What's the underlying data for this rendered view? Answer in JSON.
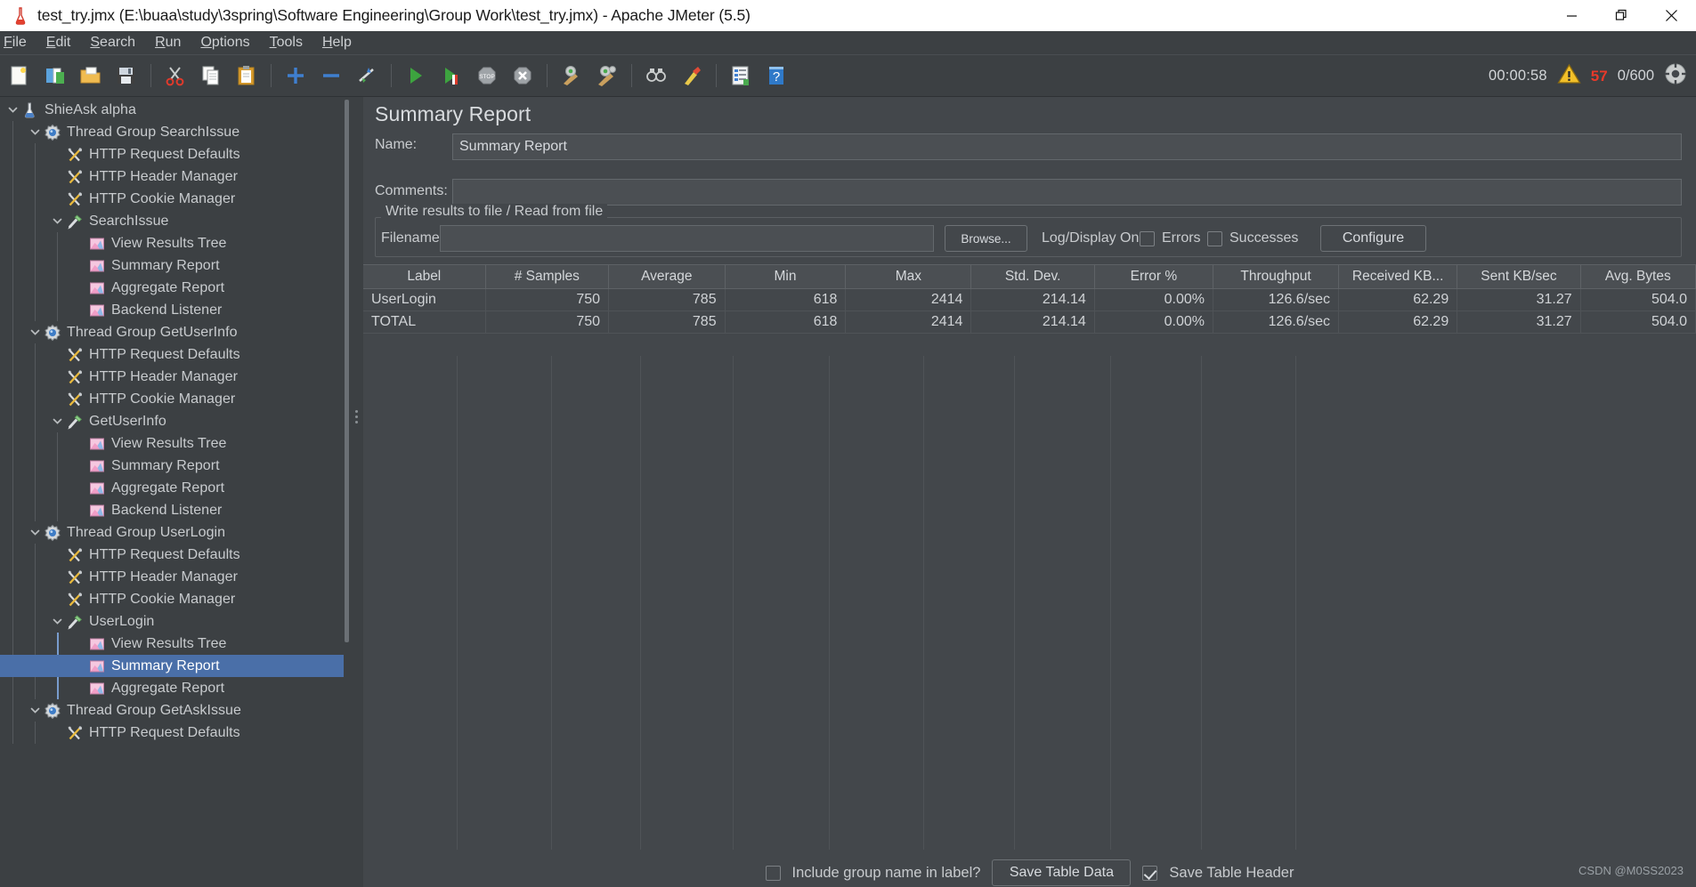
{
  "window": {
    "title": "test_try.jmx (E:\\buaa\\study\\3spring\\Software Engineering\\Group Work\\test_try.jmx) - Apache JMeter (5.5)",
    "app_icon": "jmeter-icon",
    "minimize_label": "Minimize",
    "maximize_label": "Restore",
    "close_label": "Close"
  },
  "menubar": {
    "items": [
      {
        "label": "File",
        "mnemonic": "F"
      },
      {
        "label": "Edit",
        "mnemonic": "E"
      },
      {
        "label": "Search",
        "mnemonic": "S"
      },
      {
        "label": "Run",
        "mnemonic": "R"
      },
      {
        "label": "Options",
        "mnemonic": "O"
      },
      {
        "label": "Tools",
        "mnemonic": "T"
      },
      {
        "label": "Help",
        "mnemonic": "H"
      }
    ]
  },
  "toolbar": {
    "buttons": [
      {
        "name": "new-icon",
        "tooltip": "New"
      },
      {
        "name": "templates-icon",
        "tooltip": "Templates"
      },
      {
        "name": "open-icon",
        "tooltip": "Open"
      },
      {
        "name": "save-icon",
        "tooltip": "Save"
      },
      {
        "name": "cut-icon",
        "tooltip": "Cut"
      },
      {
        "name": "copy-icon",
        "tooltip": "Copy"
      },
      {
        "name": "paste-icon",
        "tooltip": "Paste"
      },
      {
        "name": "expand-all-icon",
        "tooltip": "Expand All"
      },
      {
        "name": "collapse-all-icon",
        "tooltip": "Collapse All"
      },
      {
        "name": "toggle-icon",
        "tooltip": "Toggle"
      },
      {
        "name": "start-icon",
        "tooltip": "Start"
      },
      {
        "name": "start-no-pauses-icon",
        "tooltip": "Start no pauses"
      },
      {
        "name": "stop-icon",
        "tooltip": "Stop"
      },
      {
        "name": "shutdown-icon",
        "tooltip": "Shutdown"
      },
      {
        "name": "clear-icon",
        "tooltip": "Clear"
      },
      {
        "name": "clear-all-icon",
        "tooltip": "Clear All"
      },
      {
        "name": "search-icon",
        "tooltip": "Search"
      },
      {
        "name": "search-reset-icon",
        "tooltip": "Reset Search"
      },
      {
        "name": "function-helper-icon",
        "tooltip": "Function Helper Dialog"
      },
      {
        "name": "help-icon",
        "tooltip": "Help"
      }
    ],
    "status": {
      "elapsed_time": "00:00:58",
      "warning_icon": "warning-triangle-icon",
      "warning_count": "57",
      "active_threads": "0/600",
      "connection_icon": "connection-status-icon"
    }
  },
  "tree": {
    "items": [
      {
        "label": "ShieAsk alpha",
        "indent": 0,
        "icon": "test-plan-icon",
        "twisty": "down",
        "selected": false
      },
      {
        "label": "Thread Group SearchIssue",
        "indent": 1,
        "icon": "thread-group-icon",
        "twisty": "down",
        "selected": false
      },
      {
        "label": "HTTP Request Defaults",
        "indent": 2,
        "icon": "config-element-icon",
        "twisty": "none",
        "selected": false
      },
      {
        "label": "HTTP Header Manager",
        "indent": 2,
        "icon": "config-element-icon",
        "twisty": "none",
        "selected": false
      },
      {
        "label": "HTTP Cookie Manager",
        "indent": 2,
        "icon": "config-element-icon",
        "twisty": "none",
        "selected": false
      },
      {
        "label": "SearchIssue",
        "indent": 2,
        "icon": "http-sampler-icon",
        "twisty": "down",
        "selected": false
      },
      {
        "label": "View Results Tree",
        "indent": 3,
        "icon": "listener-icon",
        "twisty": "none",
        "selected": false
      },
      {
        "label": "Summary Report",
        "indent": 3,
        "icon": "listener-icon",
        "twisty": "none",
        "selected": false
      },
      {
        "label": "Aggregate Report",
        "indent": 3,
        "icon": "listener-icon",
        "twisty": "none",
        "selected": false
      },
      {
        "label": "Backend Listener",
        "indent": 3,
        "icon": "listener-icon",
        "twisty": "none",
        "selected": false
      },
      {
        "label": "Thread Group GetUserInfo",
        "indent": 1,
        "icon": "thread-group-icon",
        "twisty": "down",
        "selected": false
      },
      {
        "label": "HTTP Request Defaults",
        "indent": 2,
        "icon": "config-element-icon",
        "twisty": "none",
        "selected": false
      },
      {
        "label": "HTTP Header Manager",
        "indent": 2,
        "icon": "config-element-icon",
        "twisty": "none",
        "selected": false
      },
      {
        "label": "HTTP Cookie Manager",
        "indent": 2,
        "icon": "config-element-icon",
        "twisty": "none",
        "selected": false
      },
      {
        "label": "GetUserInfo",
        "indent": 2,
        "icon": "http-sampler-icon",
        "twisty": "down",
        "selected": false
      },
      {
        "label": "View Results Tree",
        "indent": 3,
        "icon": "listener-icon",
        "twisty": "none",
        "selected": false
      },
      {
        "label": "Summary Report",
        "indent": 3,
        "icon": "listener-icon",
        "twisty": "none",
        "selected": false
      },
      {
        "label": "Aggregate Report",
        "indent": 3,
        "icon": "listener-icon",
        "twisty": "none",
        "selected": false
      },
      {
        "label": "Backend Listener",
        "indent": 3,
        "icon": "listener-icon",
        "twisty": "none",
        "selected": false
      },
      {
        "label": "Thread Group UserLogin",
        "indent": 1,
        "icon": "thread-group-icon",
        "twisty": "down",
        "selected": false
      },
      {
        "label": "HTTP Request Defaults",
        "indent": 2,
        "icon": "config-element-icon",
        "twisty": "none",
        "selected": false
      },
      {
        "label": "HTTP Header Manager",
        "indent": 2,
        "icon": "config-element-icon",
        "twisty": "none",
        "selected": false
      },
      {
        "label": "HTTP Cookie Manager",
        "indent": 2,
        "icon": "config-element-icon",
        "twisty": "none",
        "selected": false
      },
      {
        "label": "UserLogin",
        "indent": 2,
        "icon": "http-sampler-icon",
        "twisty": "down",
        "selected": false
      },
      {
        "label": "View Results Tree",
        "indent": 3,
        "icon": "listener-icon",
        "twisty": "none",
        "selected": false
      },
      {
        "label": "Summary Report",
        "indent": 3,
        "icon": "listener-icon",
        "twisty": "none",
        "selected": true
      },
      {
        "label": "Aggregate Report",
        "indent": 3,
        "icon": "listener-icon",
        "twisty": "none",
        "selected": false
      },
      {
        "label": "Thread Group GetAskIssue",
        "indent": 1,
        "icon": "thread-group-icon",
        "twisty": "down",
        "selected": false
      },
      {
        "label": "HTTP Request Defaults",
        "indent": 2,
        "icon": "config-element-icon",
        "twisty": "none",
        "selected": false
      }
    ]
  },
  "main": {
    "title": "Summary Report",
    "name_label": "Name:",
    "name_value": "Summary Report",
    "comments_label": "Comments:",
    "comments_value": "",
    "group_title": "Write results to file / Read from file",
    "filename_label": "Filename",
    "filename_value": "",
    "browse_label": "Browse...",
    "log_display_label": "Log/Display Only:",
    "errors_label": "Errors",
    "errors_checked": false,
    "successes_label": "Successes",
    "successes_checked": false,
    "configure_label": "Configure"
  },
  "table": {
    "columns": [
      "Label",
      "# Samples",
      "Average",
      "Min",
      "Max",
      "Std. Dev.",
      "Error %",
      "Throughput",
      "Received KB...",
      "Sent KB/sec",
      "Avg. Bytes"
    ],
    "rows": [
      [
        "UserLogin",
        "750",
        "785",
        "618",
        "2414",
        "214.14",
        "0.00%",
        "126.6/sec",
        "62.29",
        "31.27",
        "504.0"
      ],
      [
        "TOTAL",
        "750",
        "785",
        "618",
        "2414",
        "214.14",
        "0.00%",
        "126.6/sec",
        "62.29",
        "31.27",
        "504.0"
      ]
    ]
  },
  "bottom": {
    "include_group_label": "Include group name in label?",
    "include_group_checked": false,
    "save_table_data_label": "Save Table Data",
    "save_table_header_label": "Save Table Header",
    "save_table_header_checked": true
  },
  "watermark": "CSDN @M0SS2023",
  "colors": {
    "window_bg": "#3c4043",
    "panel_bg": "#43474b",
    "selection": "#4a6fa8",
    "text": "#c8cbce",
    "error_red": "#e8392a",
    "warning_yellow": "#f2c029"
  }
}
